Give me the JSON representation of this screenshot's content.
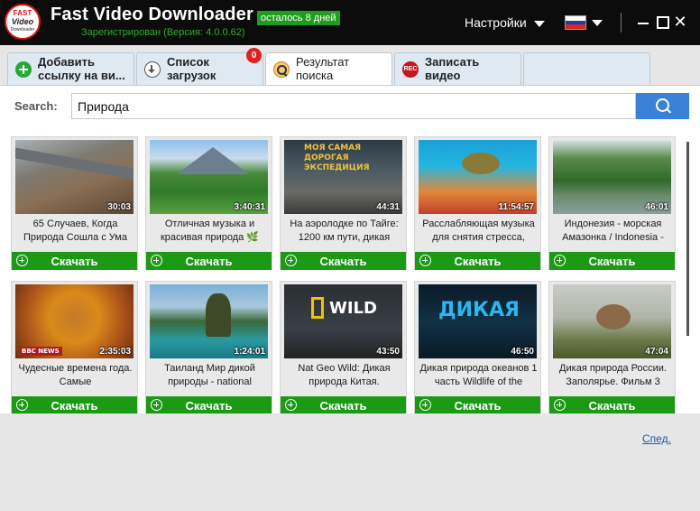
{
  "app": {
    "logo_line1": "FAST",
    "logo_line2": "Video",
    "logo_line3": "Downloader",
    "title": "Fast Video Downloader",
    "trial_badge": "осталось 8 дней",
    "registration": "Зарегистрирован (Версия: 4.0.0.62)",
    "settings_label": "Настройки",
    "language": "ru",
    "close_glyph": "✕"
  },
  "tabs": [
    {
      "label": "Добавить\nссылку  на ви...",
      "icon": "add-icon"
    },
    {
      "label": "Список\nзагрузок",
      "icon": "download-icon",
      "badge": "0"
    },
    {
      "label": "Результат\nпоиска",
      "icon": "search-icon",
      "active": true
    },
    {
      "label": "Записать\nвидео",
      "icon": "rec-icon",
      "icon_text": "REC"
    },
    {
      "label": "",
      "icon": ""
    }
  ],
  "search": {
    "label": "Search:",
    "value": "Природа"
  },
  "download_label": "Скачать",
  "videos": [
    {
      "title": "65 Случаев, Когда Природа Сошла с Ума",
      "duration": "30:03",
      "overlay": ""
    },
    {
      "title": "Отличная музыка и красивая природа 🌿",
      "duration": "3:40:31",
      "overlay": ""
    },
    {
      "title": "На аэролодке по Тайге: 1200 км пути, дикая",
      "duration": "44:31",
      "overlay": "МОЯ САМАЯ ДОРОГАЯ ЭКСПЕДИЦИЯ"
    },
    {
      "title": "Расслабляющая музыка для снятия стресса,",
      "duration": "11:54:57",
      "overlay": ""
    },
    {
      "title": "Индонезия - морская Амазонка / Indonesia -",
      "duration": "46:01",
      "overlay": ""
    },
    {
      "title": "Чудесные времена года. Самые",
      "duration": "2:35:03",
      "overlay": "BBC NEWS"
    },
    {
      "title": "Таиланд Мир дикой природы - national",
      "duration": "1:24:01",
      "overlay": ""
    },
    {
      "title": "Nat Geo Wild: Дикая природа Китая.",
      "duration": "43:50",
      "overlay": "WILD"
    },
    {
      "title": "Дикая природа океанов 1 часть  Wildlife of the",
      "duration": "46:50",
      "overlay": "ДИКАЯ"
    },
    {
      "title": "Дикая природа России. Заполярье. Фильм 3",
      "duration": "47:04",
      "overlay": ""
    }
  ],
  "footer": {
    "help_link": "Спед."
  },
  "colors": {
    "titlebar": "#0c0c0c",
    "accent_green": "#1c9a16",
    "search_button": "#3a82d9",
    "badge_red": "#e02020"
  }
}
